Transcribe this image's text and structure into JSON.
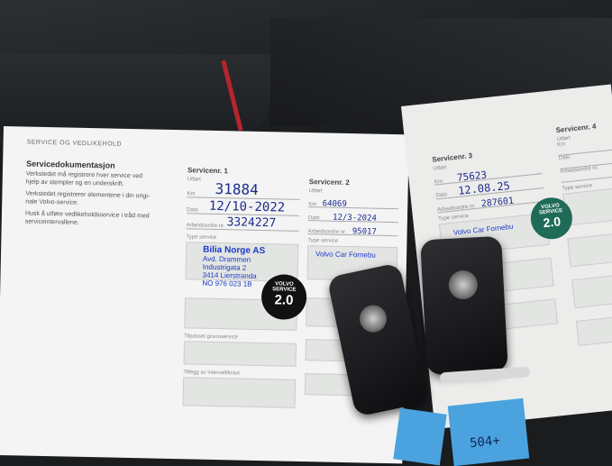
{
  "page_header": "SERVICE OG VEDLIKEHOLD",
  "doc": {
    "title": "Servicedokumentasjon",
    "lines": [
      "Verkstedet må registrere hver service ved",
      "hjelp av stempler og en underskrift.",
      "Verkstedet registrerer elementene i din origi-",
      "nale Volvo-service.",
      "Husk å utføre vedlikeholdsservice i tråd med",
      "serviceintervallene."
    ]
  },
  "services": [
    {
      "title": "Servicenr. 1",
      "km": "31884",
      "date": "12/10-2022",
      "order": "3324227"
    },
    {
      "title": "Servicenr. 2",
      "km": "64069",
      "date": "12/3-2024",
      "order": "95017"
    },
    {
      "title": "Servicenr. 3",
      "km": "75623",
      "date": "12.08.25",
      "order": "287601"
    },
    {
      "title": "Servicenr. 4"
    }
  ],
  "labels": {
    "utfort": "Utført",
    "km": "Km",
    "dato": "Dato",
    "arbeidsordre": "Arbeidsordre nr.",
    "type_service": "Type service",
    "tilpasset": "Tilpasset grunnservice",
    "tillegg": "Tillegg av intervall/kravt"
  },
  "stamp1": {
    "name": "Bilia Norge AS",
    "line1": "Avd. Drammen",
    "line2": "Industrigata 2",
    "line3": "3414 Lierstranda",
    "line4": "NO 976 023 1B"
  },
  "stamp2": {
    "name": "Volvo Car Fornebu"
  },
  "badge_black": {
    "top": "VOLVO",
    "mid": "SERVICE",
    "num": "2.0"
  },
  "badge_green": {
    "top": "VOLVO",
    "mid": "SERVICE",
    "num": "2.0"
  },
  "tag_text": "504+",
  "colors": {
    "page": "#f3f4f3",
    "ink": "#1d2b8f",
    "stamp": "#1b38c8",
    "badge_green": "#1f6b57",
    "tag": "#4aa3de"
  }
}
